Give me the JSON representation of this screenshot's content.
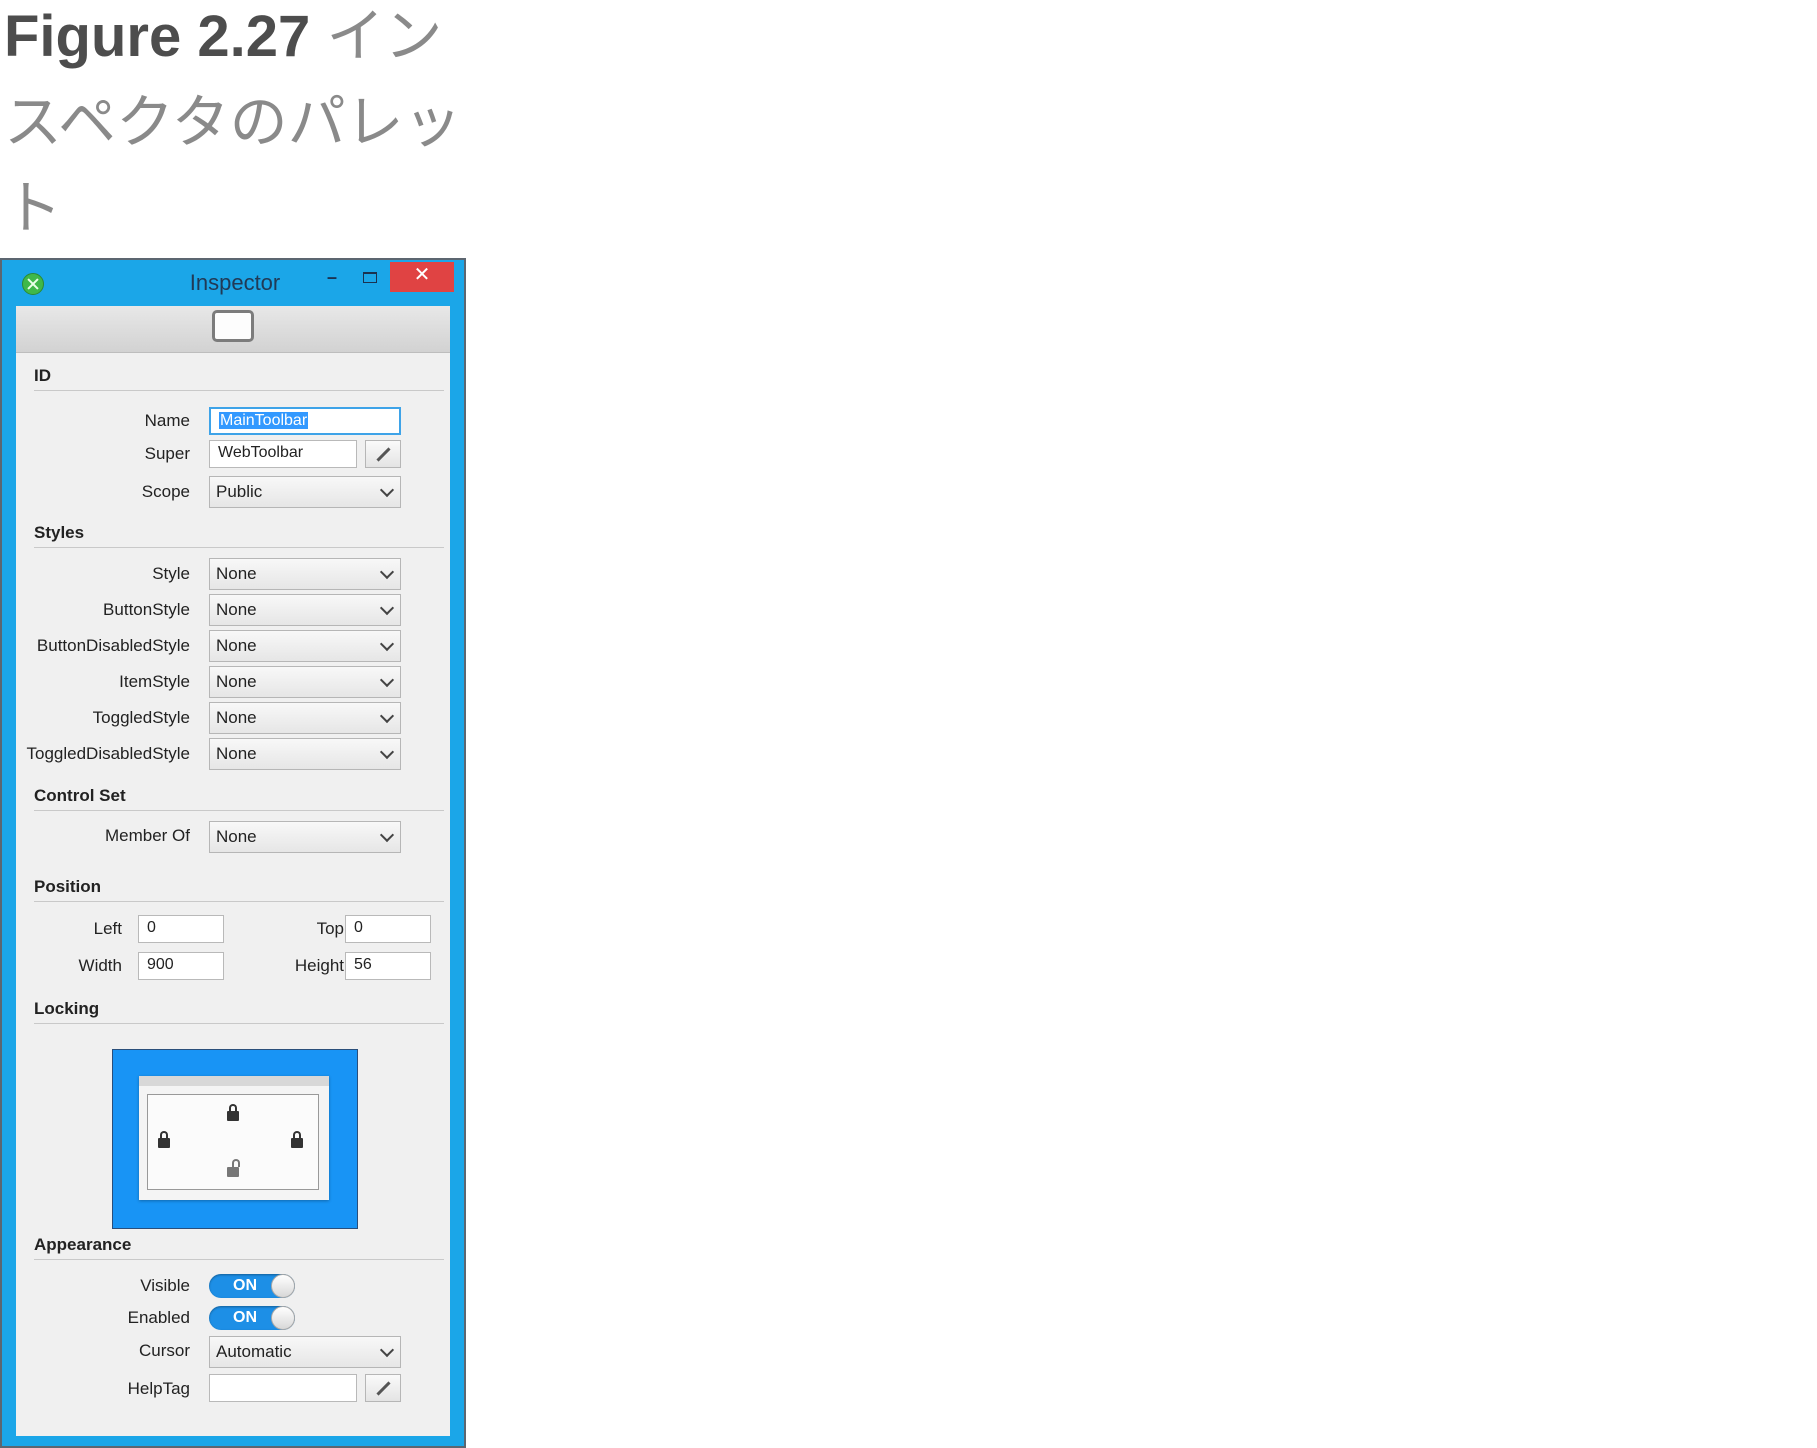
{
  "caption": {
    "figure_number": "Figure 2.27",
    "title": "インスペクタのパレット"
  },
  "window": {
    "title": "Inspector"
  },
  "id_section": {
    "heading": "ID",
    "name_label": "Name",
    "name_value": "MainToolbar",
    "super_label": "Super",
    "super_value": "WebToolbar",
    "scope_label": "Scope",
    "scope_value": "Public"
  },
  "styles_section": {
    "heading": "Styles",
    "rows": [
      {
        "label": "Style",
        "value": "None"
      },
      {
        "label": "ButtonStyle",
        "value": "None"
      },
      {
        "label": "ButtonDisabledStyle",
        "value": "None"
      },
      {
        "label": "ItemStyle",
        "value": "None"
      },
      {
        "label": "ToggledStyle",
        "value": "None"
      },
      {
        "label": "ToggledDisabledStyle",
        "value": "None"
      }
    ]
  },
  "control_set_section": {
    "heading": "Control Set",
    "member_of_label": "Member Of",
    "member_of_value": "None"
  },
  "position_section": {
    "heading": "Position",
    "left_label": "Left",
    "left_value": "0",
    "top_label": "Top",
    "top_value": "0",
    "width_label": "Width",
    "width_value": "900",
    "height_label": "Height",
    "height_value": "56"
  },
  "locking_section": {
    "heading": "Locking",
    "locks": {
      "top": "locked",
      "left": "locked",
      "right": "locked",
      "bottom": "unlocked"
    }
  },
  "appearance_section": {
    "heading": "Appearance",
    "visible_label": "Visible",
    "visible_state": "ON",
    "enabled_label": "Enabled",
    "enabled_state": "ON",
    "cursor_label": "Cursor",
    "cursor_value": "Automatic",
    "helptag_label": "HelpTag",
    "helptag_value": ""
  },
  "colors": {
    "window_frame": "#1ba6e8",
    "close_button": "#e04343",
    "selection": "#3399ff",
    "toggle_on": "#1d8fe6"
  }
}
